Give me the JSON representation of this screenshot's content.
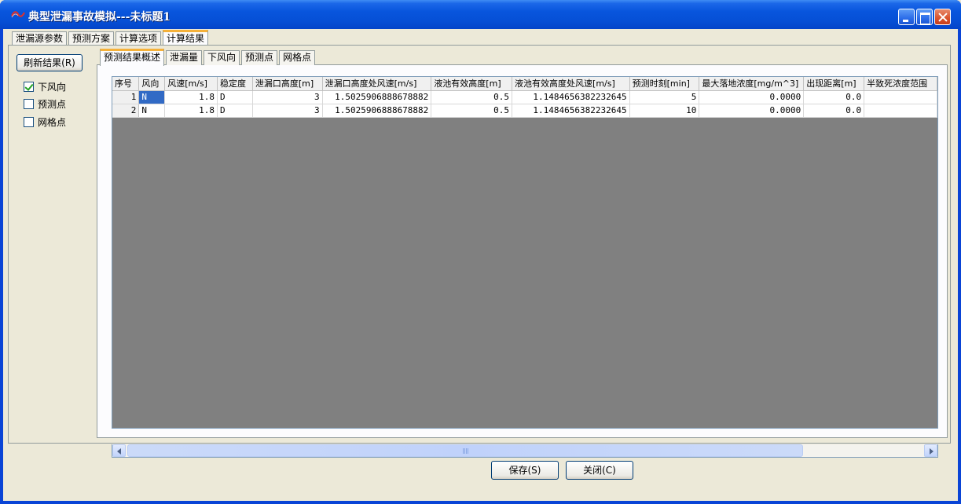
{
  "window": {
    "title": "典型泄漏事故模拟---未标题1"
  },
  "outer_tabs": [
    {
      "label": "泄漏源参数",
      "active": false
    },
    {
      "label": "预测方案",
      "active": false
    },
    {
      "label": "计算选项",
      "active": false
    },
    {
      "label": "计算结果",
      "active": true
    }
  ],
  "side": {
    "refresh_label": "刷新结果(R)",
    "checks": [
      {
        "label": "下风向",
        "checked": true
      },
      {
        "label": "预测点",
        "checked": false
      },
      {
        "label": "网格点",
        "checked": false
      }
    ]
  },
  "inner_tabs": [
    {
      "label": "预测结果概述",
      "active": true
    },
    {
      "label": "泄漏量",
      "active": false
    },
    {
      "label": "下风向",
      "active": false
    },
    {
      "label": "预测点",
      "active": false
    },
    {
      "label": "网格点",
      "active": false
    }
  ],
  "table": {
    "columns": [
      "序号",
      "风向",
      "风速[m/s]",
      "稳定度",
      "泄漏口高度[m]",
      "泄漏口高度处风速[m/s]",
      "液池有效高度[m]",
      "液池有效高度处风速[m/s]",
      "预测时刻[min]",
      "最大落地浓度[mg/m^3]",
      "出现距离[m]",
      "半致死浓度范围"
    ],
    "rows": [
      [
        "1",
        "N",
        "1.8",
        "D",
        "3",
        "1.5025906888678882",
        "0.5",
        "1.1484656382232645",
        "5",
        "0.0000",
        "0.0",
        ""
      ],
      [
        "2",
        "N",
        "1.8",
        "D",
        "3",
        "1.5025906888678882",
        "0.5",
        "1.1484656382232645",
        "10",
        "0.0000",
        "0.0",
        ""
      ]
    ]
  },
  "buttons": {
    "save_label": "保存(S)",
    "close_label": "关闭(C)"
  },
  "colors": {
    "titlebar": "#0855dd",
    "selected_cell": "#316ac5",
    "grid_empty": "#808080",
    "active_tab_accent": "#f5b13a"
  }
}
